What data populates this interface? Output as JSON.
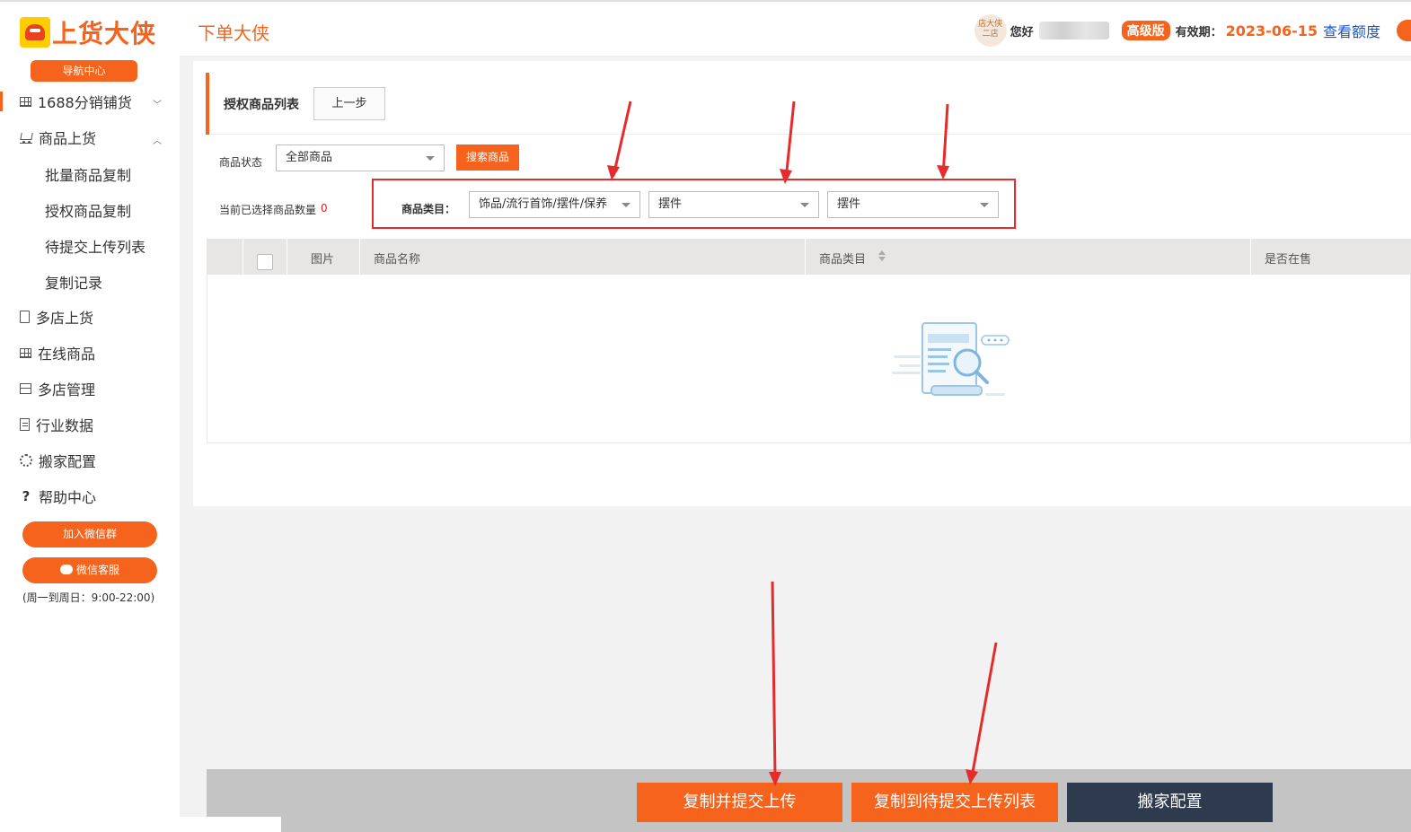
{
  "header": {
    "logo_text": "上货大侠",
    "app_name": "下单大侠",
    "avatar_text": "店大侠 二店",
    "greeting": "您好",
    "level_badge": "高级版",
    "expiry_label": "有效期：",
    "expiry_date": "2023-06-15",
    "quota_link": "查看额度"
  },
  "sidebar": {
    "nav_center": "导航中心",
    "items": [
      {
        "label": "1688分销铺货",
        "icon": "grid-icon"
      },
      {
        "label": "商品上货",
        "icon": "cart-icon"
      },
      {
        "label": "批量商品复制"
      },
      {
        "label": "授权商品复制"
      },
      {
        "label": "待提交上传列表"
      },
      {
        "label": "复制记录"
      },
      {
        "label": "多店上货",
        "icon": "document-icon"
      },
      {
        "label": "在线商品",
        "icon": "grid-icon"
      },
      {
        "label": "多店管理",
        "icon": "store-icon"
      },
      {
        "label": "行业数据",
        "icon": "data-icon"
      },
      {
        "label": "搬家配置",
        "icon": "gear-icon"
      },
      {
        "label": "帮助中心",
        "icon": "question-icon"
      }
    ],
    "join_wechat": "加入微信群",
    "wechat_service": "微信客服",
    "service_hours": "(周一到周日：9:00-22:00)"
  },
  "main": {
    "title": "授权商品列表",
    "prev_button": "上一步",
    "status_label": "商品状态",
    "status_value": "全部商品",
    "search_button": "搜索商品",
    "selected_label": "当前已选择商品数量",
    "selected_count": "0",
    "category_label": "商品类目：",
    "category_1": "饰品/流行首饰/摆件/保养",
    "category_2": "摆件",
    "category_3": "摆件",
    "table_headers": [
      "图片",
      "商品名称",
      "商品类目",
      "是否在售"
    ]
  },
  "actions": {
    "copy_submit": "复制并提交上传",
    "copy_to_pending": "复制到待提交上传列表",
    "migrate_config": "搬家配置"
  },
  "colors": {
    "accent": "#f5631c",
    "highlight": "#e62b2b",
    "dark_button": "#2e3b4e",
    "link": "#1a56c9"
  }
}
